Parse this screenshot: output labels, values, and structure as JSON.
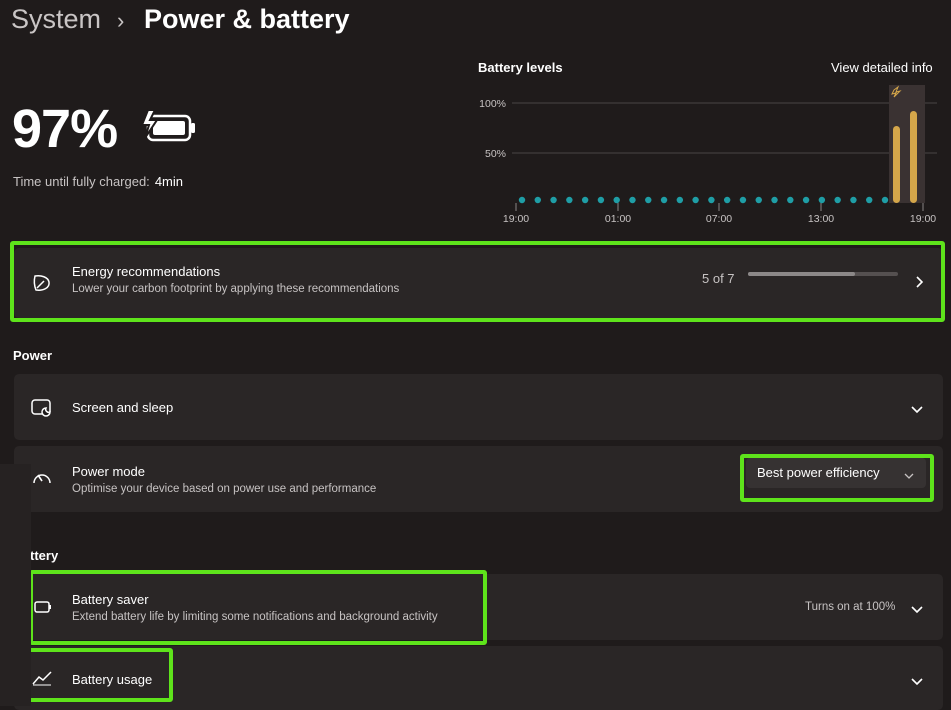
{
  "breadcrumb": {
    "parent": "System",
    "separator": "›",
    "title": "Power & battery"
  },
  "battery": {
    "percent": "97%",
    "charge_label": "Time until fully charged:",
    "charge_time": "4min"
  },
  "chart_header": {
    "title": "Battery levels",
    "link": "View detailed info"
  },
  "chart_data": {
    "type": "bar",
    "title": "Battery levels",
    "y_ticks": [
      "100%",
      "50%"
    ],
    "x_ticks": [
      "19:00",
      "01:00",
      "07:00",
      "13:00",
      "19:00"
    ],
    "ylim": [
      0,
      100
    ],
    "empty_points": 24,
    "bars": [
      {
        "value": 77,
        "color": "#d4a64a"
      },
      {
        "value": 92,
        "color": "#d4a64a"
      }
    ],
    "dot_color": "#1f9ea6"
  },
  "energy": {
    "title": "Energy recommendations",
    "subtitle": "Lower your carbon footprint by applying these recommendations",
    "count": "5 of 7",
    "progress": 0.71
  },
  "power_section": {
    "label": "Power"
  },
  "screen_sleep": {
    "title": "Screen and sleep"
  },
  "power_mode": {
    "title": "Power mode",
    "subtitle": "Optimise your device based on power use and performance",
    "selected": "Best power efficiency"
  },
  "battery_section": {
    "label": "ttery"
  },
  "battery_saver": {
    "title": "Battery saver",
    "subtitle": "Extend battery life by limiting some notifications and background activity",
    "status": "Turns on at 100%"
  },
  "battery_usage": {
    "title": "Battery usage"
  },
  "colors": {
    "highlight": "#5ee31b",
    "accent_bar": "#d4a64a",
    "dot": "#1f9ea6"
  }
}
